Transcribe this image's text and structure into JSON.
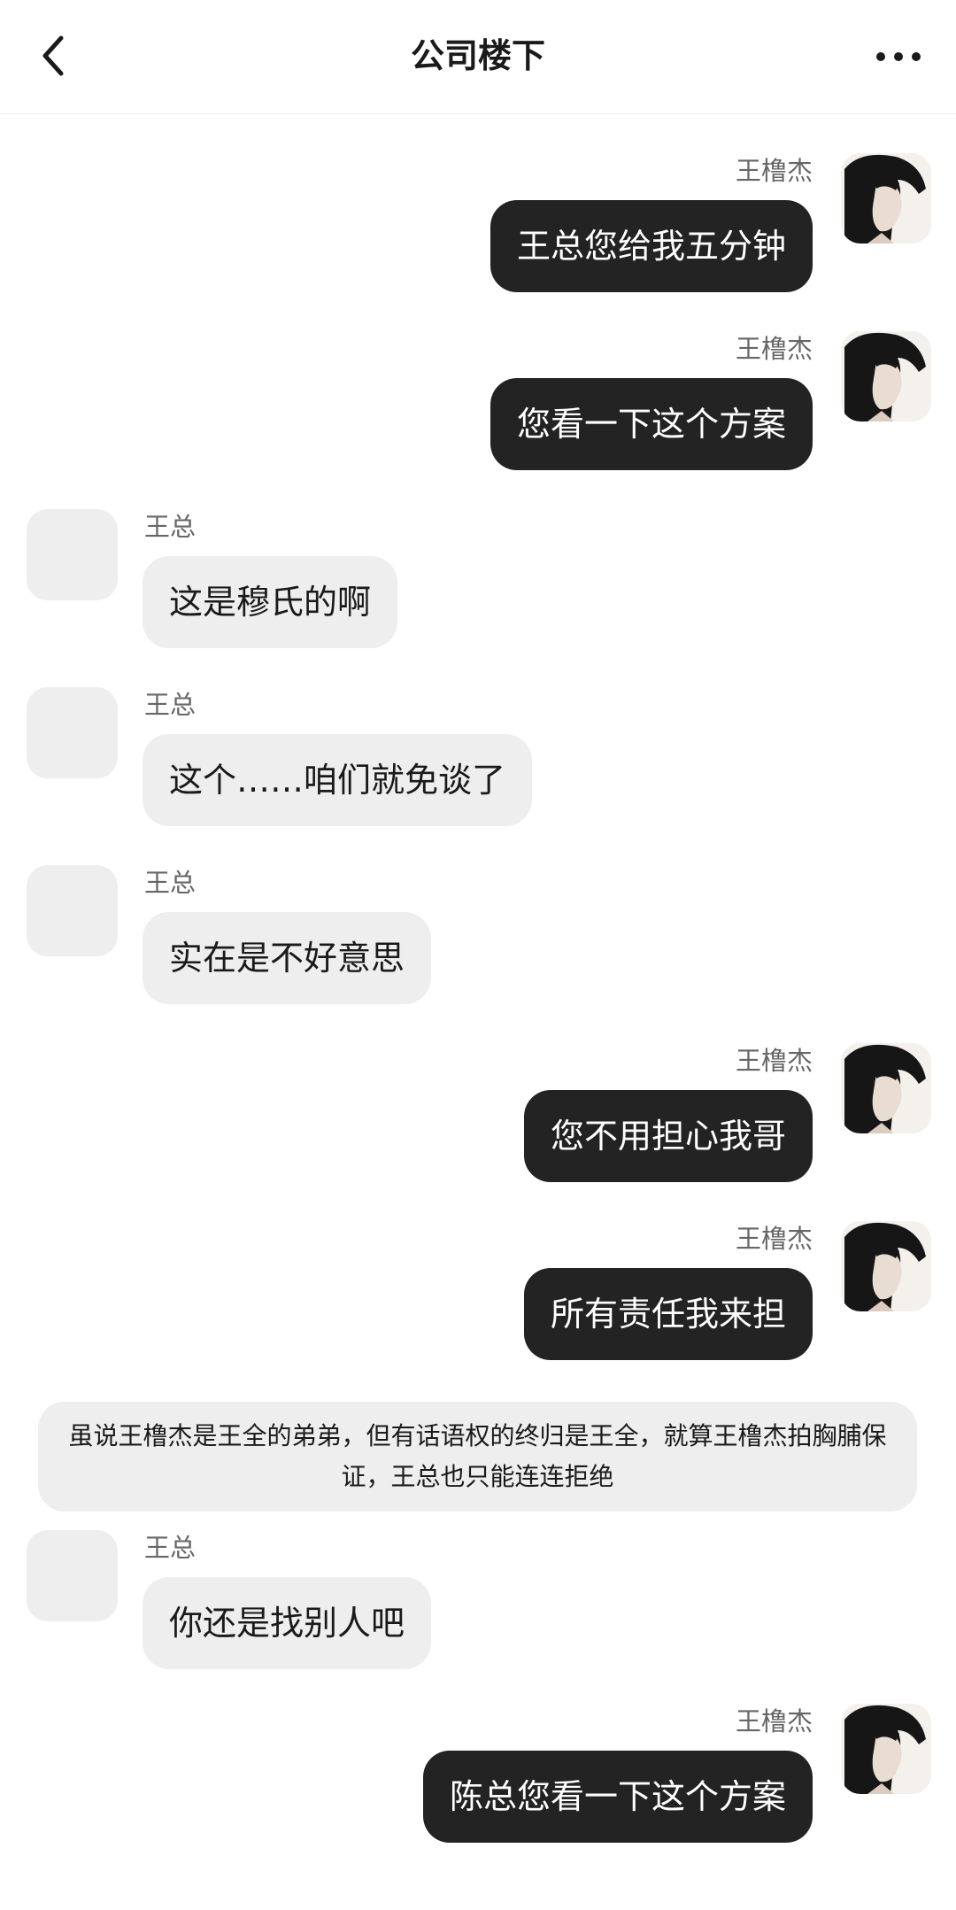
{
  "header": {
    "title": "公司楼下",
    "back_icon": "chevron-left-icon",
    "more_icon": "more-horizontal-icon"
  },
  "self_name": "王橹杰",
  "other_name": "王总",
  "messages": [
    {
      "side": "right",
      "sender": "王橹杰",
      "text": "王总您给我五分钟"
    },
    {
      "side": "right",
      "sender": "王橹杰",
      "text": "您看一下这个方案"
    },
    {
      "side": "left",
      "sender": "王总",
      "text": "这是穆氏的啊"
    },
    {
      "side": "left",
      "sender": "王总",
      "text": "这个……咱们就免谈了"
    },
    {
      "side": "left",
      "sender": "王总",
      "text": "实在是不好意思"
    },
    {
      "side": "right",
      "sender": "王橹杰",
      "text": "您不用担心我哥"
    },
    {
      "side": "right",
      "sender": "王橹杰",
      "text": "所有责任我来担"
    },
    {
      "side": "left",
      "sender": "王总",
      "text": "你还是找别人吧"
    },
    {
      "side": "right",
      "sender": "王橹杰",
      "text": "陈总您看一下这个方案"
    }
  ],
  "narration": {
    "text": "虽说王橹杰是王全的弟弟，但有话语权的终归是王全，就算王橹杰拍胸脯保证，王总也只能连连拒绝"
  },
  "colors": {
    "self_bubble": "#232323",
    "other_bubble": "#eeeeee",
    "background": "#ffffff"
  }
}
